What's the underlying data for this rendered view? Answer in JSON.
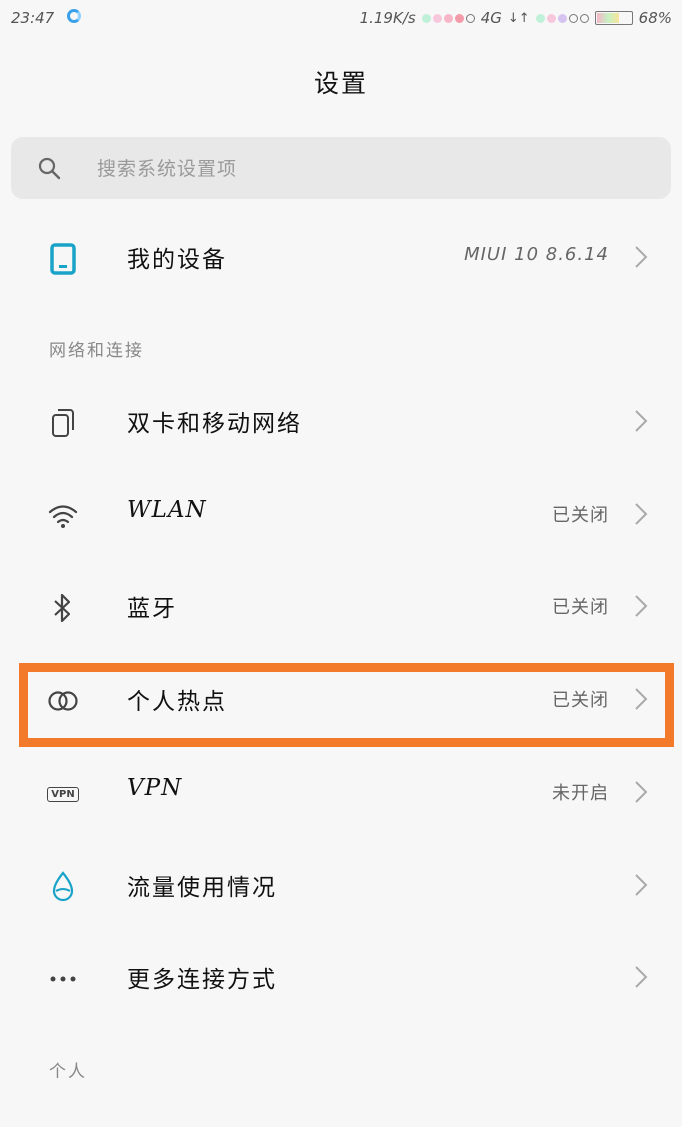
{
  "status_bar": {
    "time": "23:47",
    "speed": "1.19K/s",
    "network": "4G",
    "battery": "68%",
    "battery_level": 0.68
  },
  "page": {
    "title": "设置"
  },
  "search": {
    "placeholder": "搜索系统设置项"
  },
  "device": {
    "label": "我的设备",
    "value": "MIUI 10 8.6.14"
  },
  "sections": {
    "network": "网络和连接",
    "personal": "个人"
  },
  "network_items": [
    {
      "label": "双卡和移动网络",
      "value": "",
      "icon": "dual-sim-icon"
    },
    {
      "label": "WLAN",
      "value": "已关闭",
      "icon": "wifi-icon"
    },
    {
      "label": "蓝牙",
      "value": "已关闭",
      "icon": "bluetooth-icon"
    },
    {
      "label": "个人热点",
      "value": "已关闭",
      "icon": "hotspot-icon"
    },
    {
      "label": "VPN",
      "value": "未开启",
      "icon": "vpn-icon"
    },
    {
      "label": "流量使用情况",
      "value": "",
      "icon": "data-usage-icon"
    },
    {
      "label": "更多连接方式",
      "value": "",
      "icon": "more-icon"
    }
  ],
  "icon_vpn_text": "VPN",
  "colors": {
    "highlight": "#f37a2a",
    "device_icon": "#1aa3c8"
  }
}
